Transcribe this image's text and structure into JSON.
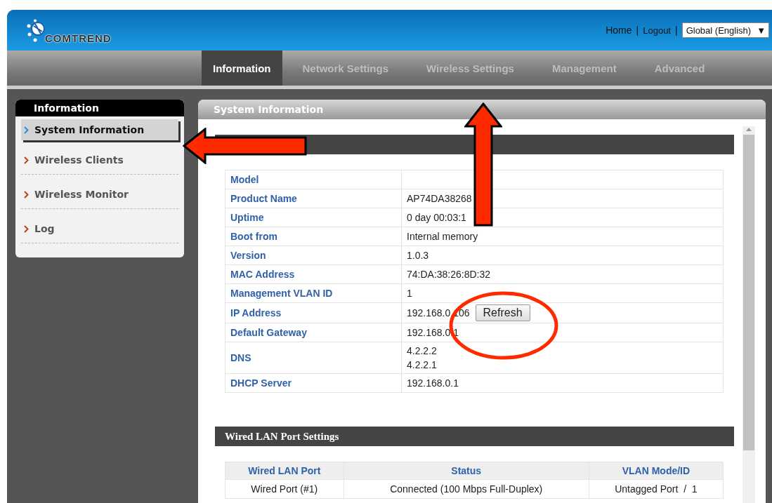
{
  "header": {
    "logo": "COMTREND",
    "links": [
      "Home",
      "Logout"
    ],
    "separator": "|",
    "language": "Global (English)",
    "dropdown_arrow": "▼"
  },
  "nav": [
    {
      "label": "Information",
      "selected": true
    },
    {
      "label": "Network Settings",
      "selected": false
    },
    {
      "label": "Wireless Settings",
      "selected": false
    },
    {
      "label": "Management",
      "selected": false
    },
    {
      "label": "Advanced",
      "selected": false
    }
  ],
  "sidebar": {
    "title": "Information",
    "items": [
      {
        "label": "System Information",
        "selected": true
      },
      {
        "label": "Wireless Clients",
        "selected": false
      },
      {
        "label": "Wireless Monitor",
        "selected": false
      },
      {
        "label": "Log",
        "selected": false
      }
    ]
  },
  "panel": {
    "title": "System Information",
    "system_rows": [
      {
        "label": "Model",
        "values": []
      },
      {
        "label": "Product Name",
        "values": [
          "AP74DA38268"
        ]
      },
      {
        "label": "Uptime",
        "values": [
          "0 day 00:03:1"
        ]
      },
      {
        "label": "Boot from",
        "values": [
          "Internal memory"
        ]
      },
      {
        "label": "Version",
        "values": [
          "1.0.3"
        ]
      },
      {
        "label": "MAC Address",
        "values": [
          "74:DA:38:26:8D:32"
        ]
      },
      {
        "label": "Management VLAN ID",
        "values": [
          "1"
        ]
      },
      {
        "label": "IP Address",
        "values": [
          "192.168.0.106"
        ],
        "button": "Refresh"
      },
      {
        "label": "Default Gateway",
        "values": [
          "192.168.0.1"
        ]
      },
      {
        "label": "DNS",
        "values": [
          "4.2.2.2",
          "4.2.2.1"
        ]
      },
      {
        "label": "DHCP Server",
        "values": [
          "192.168.0.1"
        ]
      }
    ],
    "wired": {
      "title": "Wired LAN Port Settings",
      "columns": [
        "Wired LAN Port",
        "Status",
        "VLAN Mode/ID"
      ],
      "rows": [
        [
          "Wired Port (#1)",
          "Connected (100 Mbps Full-Duplex)",
          "Untagged Port  /  1"
        ]
      ]
    }
  }
}
